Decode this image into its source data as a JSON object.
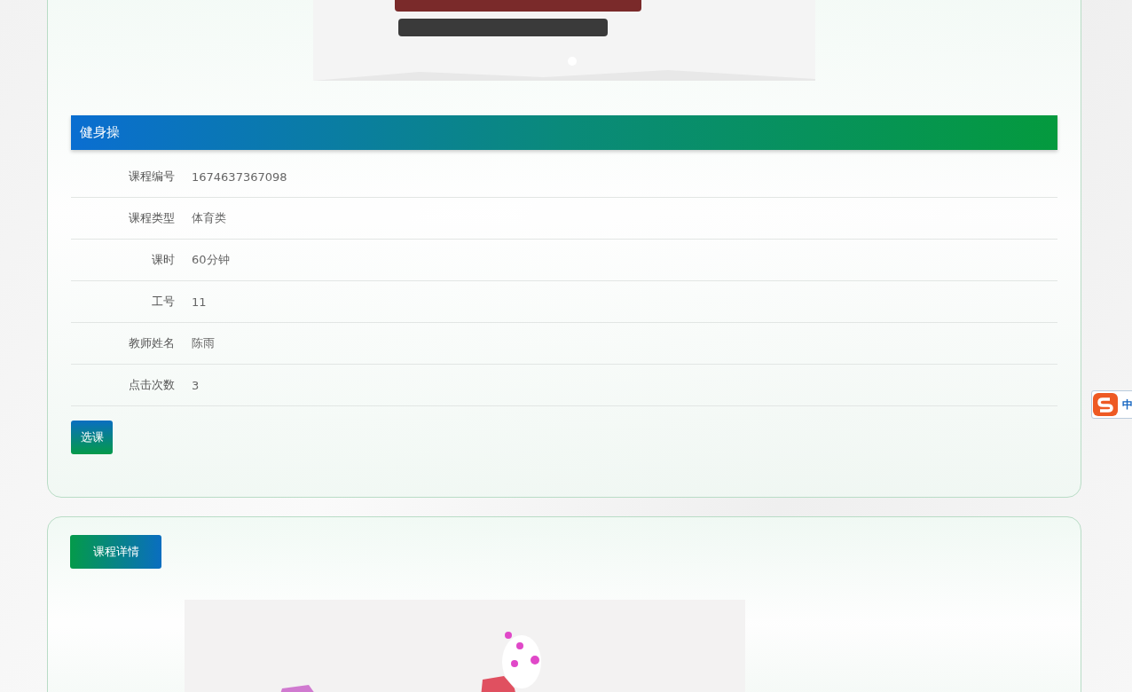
{
  "course_card": {
    "title": "健身操",
    "fields": [
      {
        "label": "课程编号",
        "value": "1674637367098"
      },
      {
        "label": "课程类型",
        "value": "体育类"
      },
      {
        "label": "课时",
        "value": "60分钟"
      },
      {
        "label": "工号",
        "value": "11"
      },
      {
        "label": "教师姓名",
        "value": "陈雨"
      },
      {
        "label": "点击次数",
        "value": "3"
      }
    ],
    "select_button": "选课"
  },
  "detail_card": {
    "tab_button": "课程详情"
  },
  "ime_toolbar": {
    "label": "中"
  }
}
